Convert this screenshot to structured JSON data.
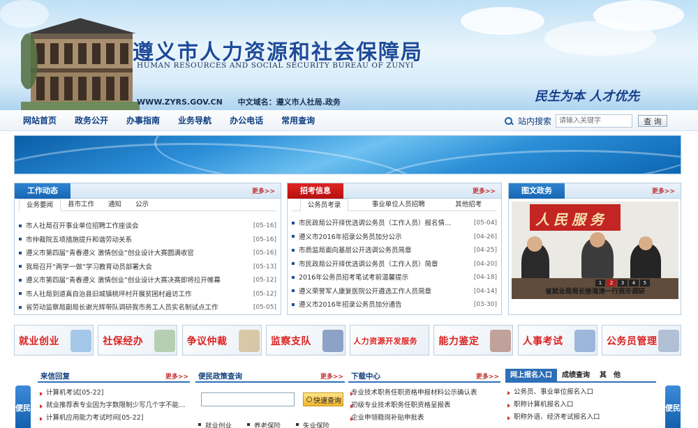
{
  "header": {
    "title": "遵义市人力资源和社会保障局",
    "subtitle_en": "HUMAN RESOURCES AND SOCIAL SECURITY BUREAU OF ZUNYI",
    "site_url": "WWW.ZYRS.GOV.CN",
    "cn_domain": "中文域名：遵义市人社局.政务",
    "slogan": "民生为本  人才优先"
  },
  "nav": {
    "items": [
      "网站首页",
      "政务公开",
      "办事指南",
      "业务导航",
      "办公电话",
      "常用查询"
    ],
    "search_label": "站内搜索",
    "search_placeholder": "请输入关键字",
    "search_button": "查 询"
  },
  "work": {
    "title": "工作动态",
    "more": "更多>>",
    "tabs": [
      "业务要闻",
      "县市工作",
      "通知",
      "公示"
    ],
    "items": [
      {
        "text": "市人社局召开事业单位招聘工作座谈会",
        "date": "[05-16]"
      },
      {
        "text": "市仲裁院五项措施提升和谐劳动关系",
        "date": "[05-16]"
      },
      {
        "text": "遵义市第四届“青春遵义 激情创业”创业设计大赛圆满收官",
        "date": "[05-16]"
      },
      {
        "text": "我局召开“两学一做”学习教育动员部署大会",
        "date": "[05-13]"
      },
      {
        "text": "遵义市第四届“青春遵义 激情创业”创业设计大赛决赛即将拉开帷幕",
        "date": "[05-12]"
      },
      {
        "text": "市人社局到道真自治县旧城镇桃坪村开展贫困村遍访工作",
        "date": "[05-12]"
      },
      {
        "text": "省劳动监察局副局长谢光辉带队调研我市务工人员实名制试点工作",
        "date": "[05-05]"
      }
    ]
  },
  "exam": {
    "title": "招考信息",
    "more": "更多>>",
    "tabs": [
      "公务员考录",
      "事业单位人员招聘",
      "其他招考"
    ],
    "items": [
      {
        "text": "市民政局公开择优选调公务员（工作人员）报名情…",
        "date": "[05-04]"
      },
      {
        "text": "遵义市2016年招录公务员加分公示",
        "date": "[04-26]"
      },
      {
        "text": "市质监局面向基层公开选调公务员简章",
        "date": "[04-25]"
      },
      {
        "text": "市民政局公开择优选调公务员（工作人员）简章",
        "date": "[04-20]"
      },
      {
        "text": "2016年公务员招考笔试考前温馨提示",
        "date": "[04-18]"
      },
      {
        "text": "遵义荣誉军人康复医院公开遴选工作人员简章",
        "date": "[04-14]"
      },
      {
        "text": "遵义市2016年招录公务员加分通告",
        "date": "[03-30]"
      }
    ]
  },
  "photo": {
    "title": "图文政务",
    "more": "更多>>",
    "banner_text": "人民服务",
    "caption": "省就业局局长徐海涛一行我市调研",
    "pages": [
      "1",
      "2",
      "3",
      "4",
      "5"
    ],
    "active_page": "2"
  },
  "services": [
    "就业创业",
    "社保经办",
    "争议仲裁",
    "监察支队",
    "人力资源开发服务",
    "能力鉴定",
    "人事考试",
    "公务员管理"
  ],
  "letters": {
    "title": "来信回复",
    "more": "更多>>",
    "items": [
      "计算机考试[05-22]",
      "就业推荐表专业因为字数限制少写几个字不能…",
      "计算机应用能力考试时间[05-22]"
    ]
  },
  "policy": {
    "title": "便民政策查询",
    "more": "更多>>",
    "button": "快速查询",
    "links": [
      "就业创业",
      "养老保险",
      "失业保险"
    ]
  },
  "downloads": {
    "title": "下载中心",
    "more": "更多>>",
    "items": [
      "专业技术职务任职资格申报材料公示确认表",
      "初级专业技术职务任职资格呈报表",
      "企业申领稳岗补贴申批表"
    ]
  },
  "registration": {
    "tabs": [
      "网上报名入口",
      "成绩查询",
      "其　他"
    ],
    "items": [
      "公务员、事业单位报名入口",
      "职称计算机报名入口",
      "职称外语、经济考试报名入口"
    ]
  },
  "side": {
    "left": "便民",
    "right": "便民"
  }
}
